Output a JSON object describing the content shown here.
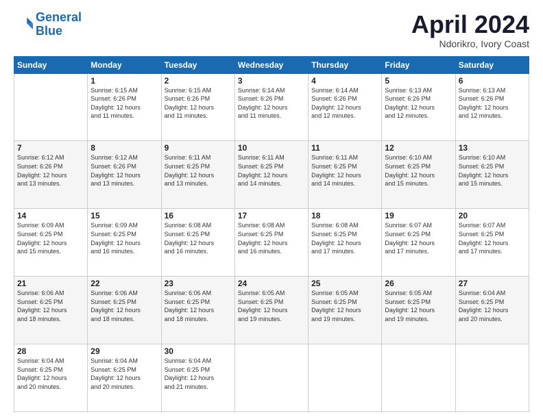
{
  "header": {
    "logo_line1": "General",
    "logo_line2": "Blue",
    "title": "April 2024",
    "subtitle": "Ndorikro, Ivory Coast"
  },
  "weekdays": [
    "Sunday",
    "Monday",
    "Tuesday",
    "Wednesday",
    "Thursday",
    "Friday",
    "Saturday"
  ],
  "weeks": [
    [
      {
        "num": "",
        "text": ""
      },
      {
        "num": "1",
        "text": "Sunrise: 6:15 AM\nSunset: 6:26 PM\nDaylight: 12 hours\nand 11 minutes."
      },
      {
        "num": "2",
        "text": "Sunrise: 6:15 AM\nSunset: 6:26 PM\nDaylight: 12 hours\nand 11 minutes."
      },
      {
        "num": "3",
        "text": "Sunrise: 6:14 AM\nSunset: 6:26 PM\nDaylight: 12 hours\nand 11 minutes."
      },
      {
        "num": "4",
        "text": "Sunrise: 6:14 AM\nSunset: 6:26 PM\nDaylight: 12 hours\nand 12 minutes."
      },
      {
        "num": "5",
        "text": "Sunrise: 6:13 AM\nSunset: 6:26 PM\nDaylight: 12 hours\nand 12 minutes."
      },
      {
        "num": "6",
        "text": "Sunrise: 6:13 AM\nSunset: 6:26 PM\nDaylight: 12 hours\nand 12 minutes."
      }
    ],
    [
      {
        "num": "7",
        "text": "Sunrise: 6:12 AM\nSunset: 6:26 PM\nDaylight: 12 hours\nand 13 minutes."
      },
      {
        "num": "8",
        "text": "Sunrise: 6:12 AM\nSunset: 6:26 PM\nDaylight: 12 hours\nand 13 minutes."
      },
      {
        "num": "9",
        "text": "Sunrise: 6:11 AM\nSunset: 6:25 PM\nDaylight: 12 hours\nand 13 minutes."
      },
      {
        "num": "10",
        "text": "Sunrise: 6:11 AM\nSunset: 6:25 PM\nDaylight: 12 hours\nand 14 minutes."
      },
      {
        "num": "11",
        "text": "Sunrise: 6:11 AM\nSunset: 6:25 PM\nDaylight: 12 hours\nand 14 minutes."
      },
      {
        "num": "12",
        "text": "Sunrise: 6:10 AM\nSunset: 6:25 PM\nDaylight: 12 hours\nand 15 minutes."
      },
      {
        "num": "13",
        "text": "Sunrise: 6:10 AM\nSunset: 6:25 PM\nDaylight: 12 hours\nand 15 minutes."
      }
    ],
    [
      {
        "num": "14",
        "text": "Sunrise: 6:09 AM\nSunset: 6:25 PM\nDaylight: 12 hours\nand 15 minutes."
      },
      {
        "num": "15",
        "text": "Sunrise: 6:09 AM\nSunset: 6:25 PM\nDaylight: 12 hours\nand 16 minutes."
      },
      {
        "num": "16",
        "text": "Sunrise: 6:08 AM\nSunset: 6:25 PM\nDaylight: 12 hours\nand 16 minutes."
      },
      {
        "num": "17",
        "text": "Sunrise: 6:08 AM\nSunset: 6:25 PM\nDaylight: 12 hours\nand 16 minutes."
      },
      {
        "num": "18",
        "text": "Sunrise: 6:08 AM\nSunset: 6:25 PM\nDaylight: 12 hours\nand 17 minutes."
      },
      {
        "num": "19",
        "text": "Sunrise: 6:07 AM\nSunset: 6:25 PM\nDaylight: 12 hours\nand 17 minutes."
      },
      {
        "num": "20",
        "text": "Sunrise: 6:07 AM\nSunset: 6:25 PM\nDaylight: 12 hours\nand 17 minutes."
      }
    ],
    [
      {
        "num": "21",
        "text": "Sunrise: 6:06 AM\nSunset: 6:25 PM\nDaylight: 12 hours\nand 18 minutes."
      },
      {
        "num": "22",
        "text": "Sunrise: 6:06 AM\nSunset: 6:25 PM\nDaylight: 12 hours\nand 18 minutes."
      },
      {
        "num": "23",
        "text": "Sunrise: 6:06 AM\nSunset: 6:25 PM\nDaylight: 12 hours\nand 18 minutes."
      },
      {
        "num": "24",
        "text": "Sunrise: 6:05 AM\nSunset: 6:25 PM\nDaylight: 12 hours\nand 19 minutes."
      },
      {
        "num": "25",
        "text": "Sunrise: 6:05 AM\nSunset: 6:25 PM\nDaylight: 12 hours\nand 19 minutes."
      },
      {
        "num": "26",
        "text": "Sunrise: 6:05 AM\nSunset: 6:25 PM\nDaylight: 12 hours\nand 19 minutes."
      },
      {
        "num": "27",
        "text": "Sunrise: 6:04 AM\nSunset: 6:25 PM\nDaylight: 12 hours\nand 20 minutes."
      }
    ],
    [
      {
        "num": "28",
        "text": "Sunrise: 6:04 AM\nSunset: 6:25 PM\nDaylight: 12 hours\nand 20 minutes."
      },
      {
        "num": "29",
        "text": "Sunrise: 6:04 AM\nSunset: 6:25 PM\nDaylight: 12 hours\nand 20 minutes."
      },
      {
        "num": "30",
        "text": "Sunrise: 6:04 AM\nSunset: 6:25 PM\nDaylight: 12 hours\nand 21 minutes."
      },
      {
        "num": "",
        "text": ""
      },
      {
        "num": "",
        "text": ""
      },
      {
        "num": "",
        "text": ""
      },
      {
        "num": "",
        "text": ""
      }
    ]
  ]
}
